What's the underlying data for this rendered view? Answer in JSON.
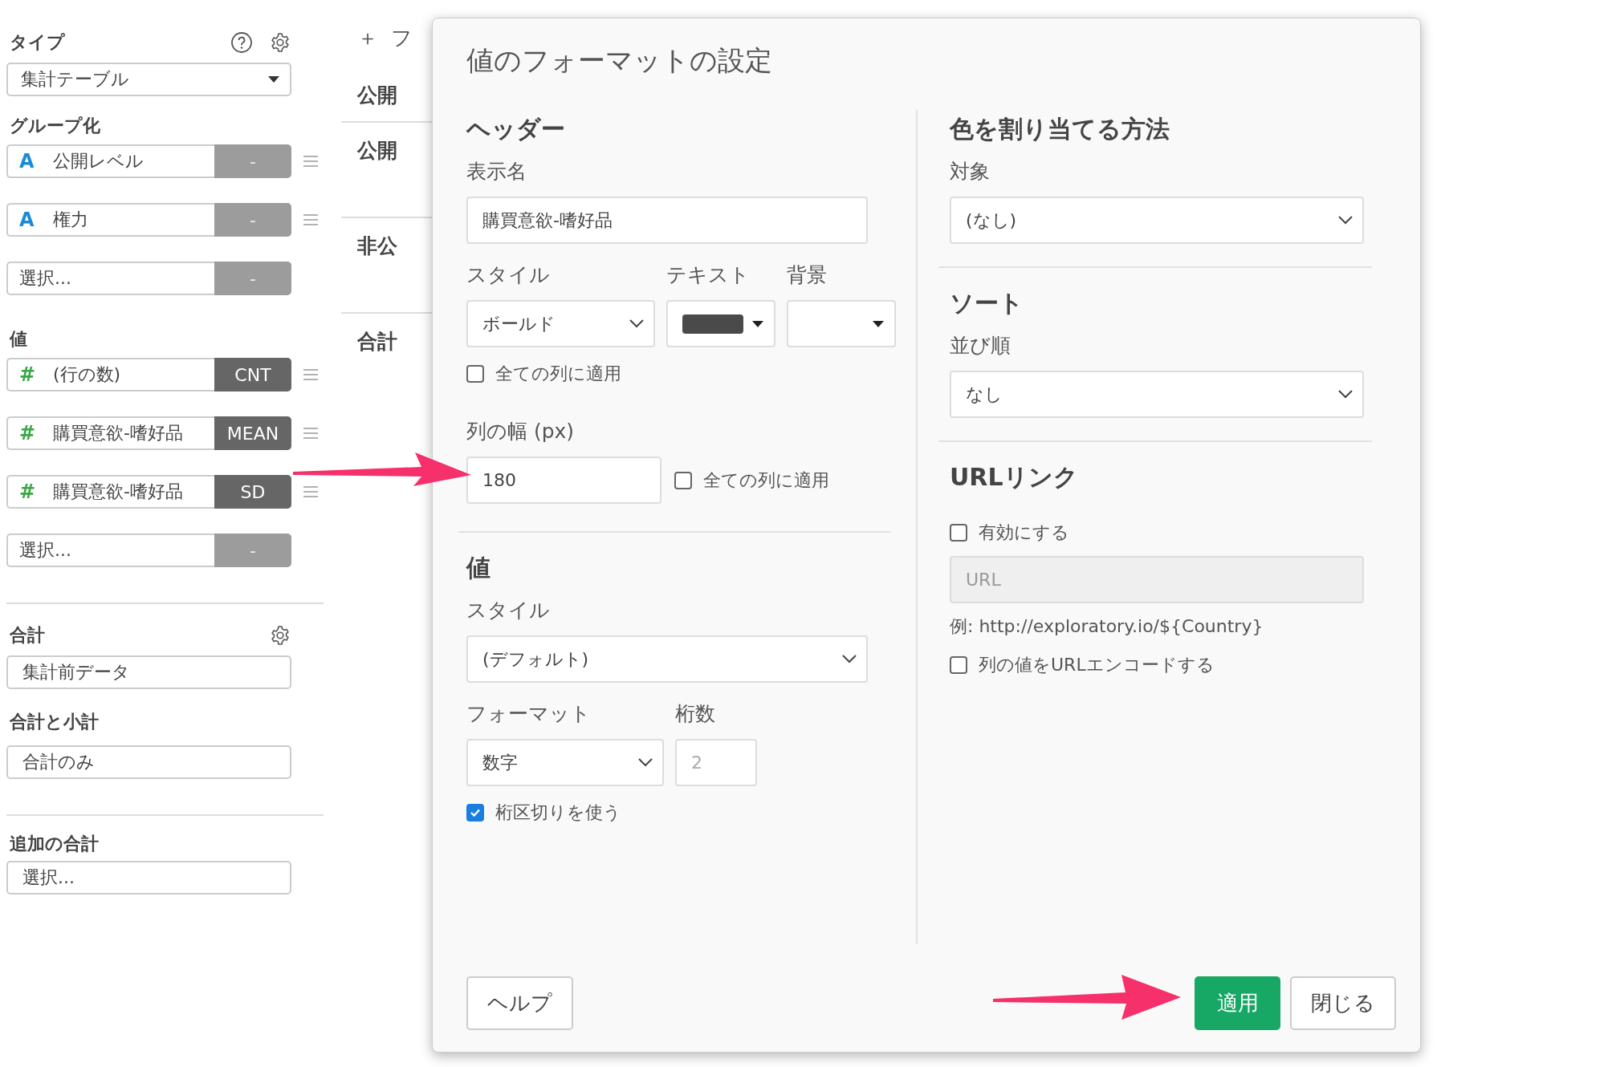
{
  "sidebar": {
    "type": {
      "label": "タイプ",
      "value": "集計テーブル"
    },
    "grouping": {
      "label": "グループ化",
      "rows": [
        {
          "kind": "text",
          "icon": "A",
          "name": "公開レベル",
          "agg": "-",
          "active": false
        },
        {
          "kind": "text",
          "icon": "A",
          "name": "権力",
          "agg": "-",
          "active": false
        },
        {
          "kind": "empty",
          "name": "選択...",
          "agg": "-",
          "active": false
        }
      ]
    },
    "values": {
      "label": "値",
      "rows": [
        {
          "kind": "number",
          "icon": "#",
          "name": "(行の数)",
          "agg": "CNT",
          "active": true
        },
        {
          "kind": "number",
          "icon": "#",
          "name": "購買意欲-嗜好品",
          "agg": "MEAN",
          "active": true
        },
        {
          "kind": "number",
          "icon": "#",
          "name": "購買意欲-嗜好品",
          "agg": "SD",
          "active": true
        },
        {
          "kind": "empty",
          "name": "選択...",
          "agg": "-",
          "active": false
        }
      ]
    },
    "total": {
      "label": "合計",
      "value": "集計前データ"
    },
    "subtotal": {
      "label": "合計と小計",
      "value": "合計のみ"
    },
    "extra_total": {
      "label": "追加の合計",
      "value": "選択..."
    }
  },
  "background_table": {
    "add_icon": "＋",
    "add_text": "フ",
    "header": "公開",
    "rows": [
      "公開",
      "非公",
      "合計"
    ]
  },
  "dialog": {
    "title": "値のフォーマットの設定",
    "header_section": {
      "heading": "ヘッダー",
      "display_name": {
        "label": "表示名",
        "value": "購買意欲-嗜好品"
      },
      "style": {
        "label": "スタイル",
        "value": "ボールド"
      },
      "text_color": {
        "label": "テキスト",
        "color": "#4a4a4a"
      },
      "background": {
        "label": "背景"
      },
      "apply_all": {
        "label": "全ての列に適用",
        "checked": false
      },
      "width": {
        "label": "列の幅 (px)",
        "value": "180"
      },
      "width_apply_all": {
        "label": "全ての列に適用",
        "checked": false
      }
    },
    "value_section": {
      "heading": "値",
      "style": {
        "label": "スタイル",
        "value": "(デフォルト)"
      },
      "format": {
        "label": "フォーマット",
        "value": "数字"
      },
      "digits": {
        "label": "桁数",
        "placeholder": "2"
      },
      "separator": {
        "label": "桁区切りを使う",
        "checked": true
      }
    },
    "color_section": {
      "heading": "色を割り当てる方法",
      "target": {
        "label": "対象",
        "value": "(なし)"
      }
    },
    "sort_section": {
      "heading": "ソート",
      "order": {
        "label": "並び順",
        "value": "なし"
      }
    },
    "url_section": {
      "heading": "URLリンク",
      "enable": {
        "label": "有効にする",
        "checked": false
      },
      "url": {
        "placeholder": "URL",
        "disabled": true
      },
      "example": "例: http://exploratory.io/${Country}",
      "encode": {
        "label": "列の値をURLエンコードする",
        "checked": false
      }
    },
    "buttons": [
      {
        "label": "ヘルプ",
        "kind": "default"
      },
      {
        "label": "適用",
        "kind": "primary"
      },
      {
        "label": "閉じる",
        "kind": "default"
      }
    ]
  }
}
